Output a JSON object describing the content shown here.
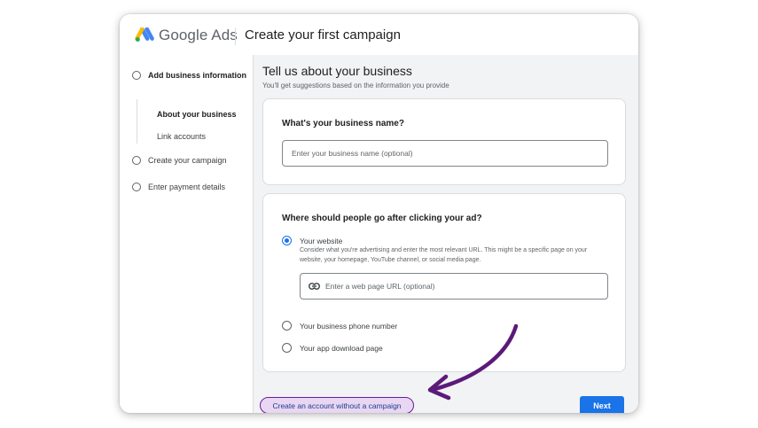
{
  "header": {
    "brand": "Google Ads",
    "page_title": "Create your first campaign"
  },
  "sidebar": {
    "steps": [
      {
        "label": "Add business information"
      },
      {
        "label": "Create your campaign"
      },
      {
        "label": "Enter payment details"
      }
    ],
    "substeps": [
      {
        "label": "About your business"
      },
      {
        "label": "Link accounts"
      }
    ]
  },
  "main": {
    "title": "Tell us about your business",
    "subtitle": "You'll get suggestions based on the information you provide",
    "business_name": {
      "question": "What's your business name?",
      "placeholder": "Enter your business name (optional)"
    },
    "destination": {
      "question": "Where should people go after clicking your ad?",
      "options": [
        {
          "label": "Your website",
          "selected": true
        },
        {
          "label": "Your business phone number",
          "selected": false
        },
        {
          "label": "Your app download page",
          "selected": false
        }
      ],
      "website_description": "Consider what you're advertising and enter the most relevant URL. This might be a specific page on your website, your homepage, YouTube channel, or social media page.",
      "url_placeholder": "Enter a web page URL (optional)"
    },
    "create_without_campaign_label": "Create an account without a campaign",
    "next_label": "Next"
  },
  "icons": {
    "logo": "google-ads-logo",
    "link": "link-icon"
  },
  "colors": {
    "primary": "#1a73e8",
    "highlight_fill": "#e9d6f2",
    "highlight_border": "#6a1b9a",
    "annotation_arrow": "#5b1a7a"
  }
}
